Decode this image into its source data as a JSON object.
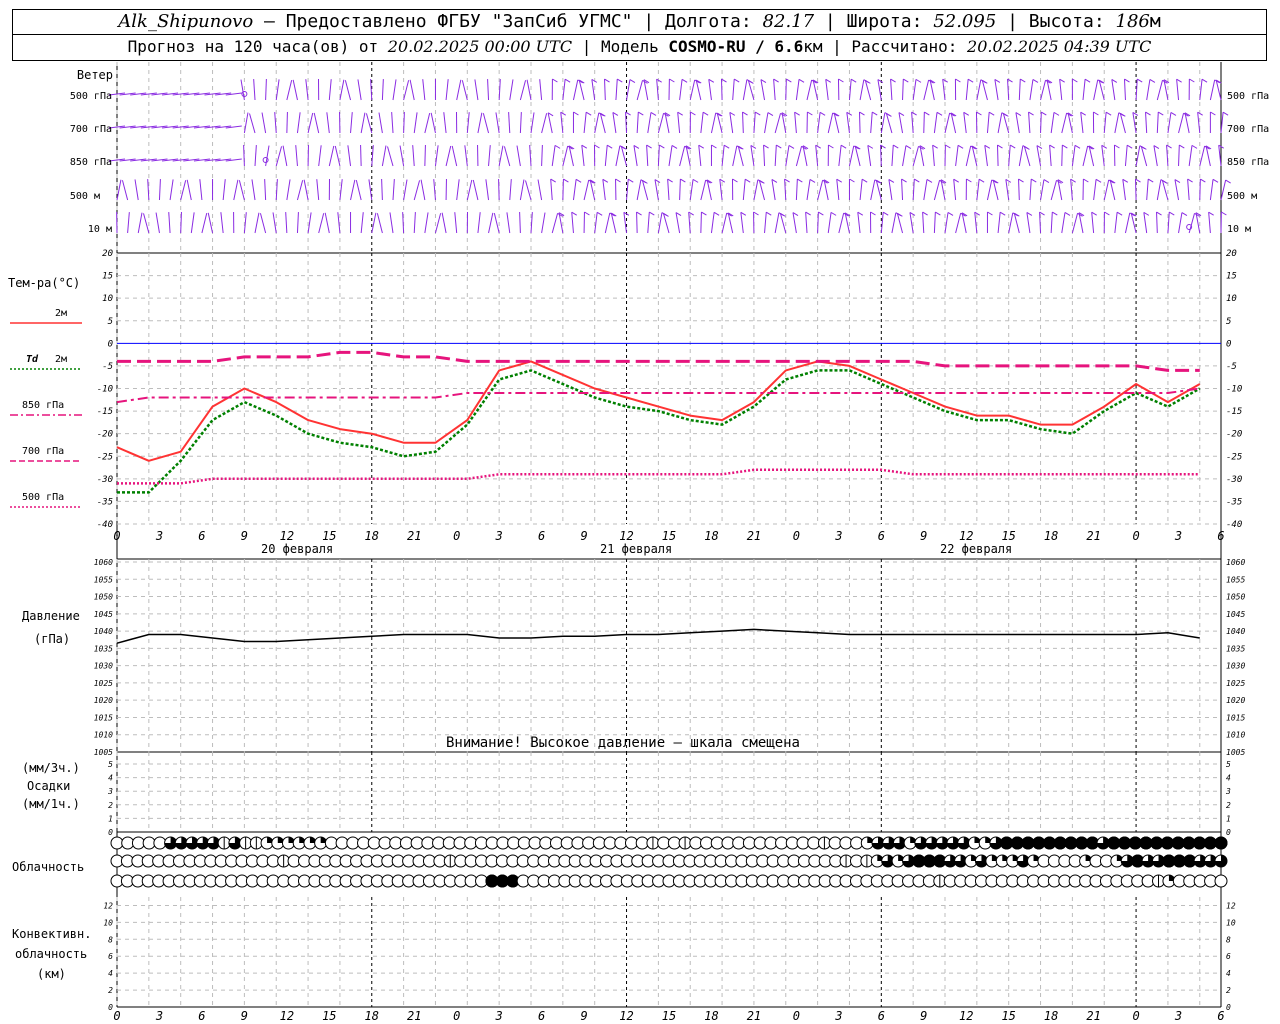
{
  "header": {
    "station": "Alk_Shipunovo",
    "provided_by": " – Предоставлено ФГБУ \"ЗапСиб УГМС\" | Долгота: ",
    "lon": "82.17",
    "lat_label": " | Широта: ",
    "lat": "52.095",
    "alt_label": " | Высота: ",
    "alt": "186",
    "alt_unit": "м",
    "forecast_label": "Прогноз на 120 часа(ов) от ",
    "forecast_from": "20.02.2025 00:00 UTC",
    "model_label": " | Модель ",
    "model": "COSMO-RU / 6.6",
    "model_unit": "км",
    "computed_label": " | Рассчитано: ",
    "computed": "20.02.2025 04:39 UTC"
  },
  "labels": {
    "wind_title": "Ветер",
    "wind_levels": [
      "500 гПа",
      "700 гПа",
      "850 гПа",
      "500 м",
      "10  м"
    ],
    "temp_title": "Тем-ра(°С)",
    "legend_t2m": "2м",
    "legend_td_sym": "Td",
    "legend_td": "2м",
    "legend_850": "850 гПа",
    "legend_700": "700 гПа",
    "legend_500": "500 гПа",
    "pressure_title": "Давление",
    "pressure_unit": "(гПа)",
    "pressure_warning": "Внимание! Высокое давление – шкала смещена",
    "precip_unit3": "(мм/3ч.)",
    "precip_title": "Осадки",
    "precip_unit1": "(мм/1ч.)",
    "cloud_title": "Облачность",
    "conv_title1": "Конвективн.",
    "conv_title2": "облачность",
    "conv_unit": "(км)",
    "days": [
      "20 февраля",
      "21 февраля",
      "22 февраля"
    ]
  },
  "colors": {
    "t2m": "#ff3333",
    "td": "#008000",
    "t850": "#e6147d",
    "t700": "#e6147d",
    "t500": "#e6147d",
    "wind": "#8a2be2",
    "zero_line": "#0000ff",
    "pressure": "#000000"
  },
  "chart_data": [
    {
      "type": "line",
      "panel": "temperature",
      "x_hours": [
        0,
        3,
        6,
        9,
        12,
        15,
        18,
        21,
        24,
        27,
        30,
        33,
        36,
        39,
        42,
        45,
        48,
        51,
        54,
        57,
        60,
        63,
        66,
        69,
        72,
        75,
        78,
        81,
        84,
        87,
        90,
        93,
        96,
        99,
        102
      ],
      "x_ticks": [
        "0",
        "3",
        "6",
        "9",
        "12",
        "15",
        "18",
        "21",
        "0",
        "3",
        "6",
        "9",
        "12",
        "15",
        "18",
        "21",
        "0",
        "3",
        "6",
        "9",
        "12",
        "15",
        "18",
        "21",
        "0",
        "3",
        "6"
      ],
      "ylim": [
        -40,
        20
      ],
      "y_ticks": [
        20,
        15,
        10,
        5,
        0,
        -5,
        -10,
        -15,
        -20,
        -25,
        -30,
        -35,
        -40
      ],
      "series": [
        {
          "name": "2м",
          "values": [
            -23,
            -26,
            -24,
            -14,
            -10,
            -13,
            -17,
            -19,
            -20,
            -22,
            -22,
            -17,
            -6,
            -4,
            -7,
            -10,
            -12,
            -14,
            -16,
            -17,
            -13,
            -6,
            -4,
            -5,
            -8,
            -11,
            -14,
            -16,
            -16,
            -18,
            -18,
            -14,
            -9,
            -13,
            -9
          ]
        },
        {
          "name": "Td 2м",
          "values": [
            -33,
            -33,
            -26,
            -17,
            -13,
            -16,
            -20,
            -22,
            -23,
            -25,
            -24,
            -18,
            -8,
            -6,
            -9,
            -12,
            -14,
            -15,
            -17,
            -18,
            -14,
            -8,
            -6,
            -6,
            -9,
            -12,
            -15,
            -17,
            -17,
            -19,
            -20,
            -15,
            -11,
            -14,
            -10
          ]
        },
        {
          "name": "850 гПа",
          "values": [
            -13,
            -12,
            -12,
            -12,
            -12,
            -12,
            -12,
            -12,
            -12,
            -12,
            -12,
            -11,
            -11,
            -11,
            -11,
            -11,
            -11,
            -11,
            -11,
            -11,
            -11,
            -11,
            -11,
            -11,
            -11,
            -11,
            -11,
            -11,
            -11,
            -11,
            -11,
            -11,
            -11,
            -11,
            -10
          ]
        },
        {
          "name": "700 гПа",
          "values": [
            -4,
            -4,
            -4,
            -4,
            -3,
            -3,
            -3,
            -2,
            -2,
            -3,
            -3,
            -4,
            -4,
            -4,
            -4,
            -4,
            -4,
            -4,
            -4,
            -4,
            -4,
            -4,
            -4,
            -4,
            -4,
            -4,
            -5,
            -5,
            -5,
            -5,
            -5,
            -5,
            -5,
            -6,
            -6
          ]
        },
        {
          "name": "500 гПа",
          "values": [
            -31,
            -31,
            -31,
            -30,
            -30,
            -30,
            -30,
            -30,
            -30,
            -30,
            -30,
            -30,
            -29,
            -29,
            -29,
            -29,
            -29,
            -29,
            -29,
            -29,
            -28,
            -28,
            -28,
            -28,
            -28,
            -29,
            -29,
            -29,
            -29,
            -29,
            -29,
            -29,
            -29,
            -29,
            -29
          ]
        }
      ]
    },
    {
      "type": "line",
      "panel": "pressure",
      "ylim": [
        1005,
        1060
      ],
      "y_ticks": [
        1060,
        1055,
        1050,
        1045,
        1040,
        1035,
        1030,
        1025,
        1020,
        1015,
        1010,
        1005
      ],
      "series": [
        {
          "name": "Давление",
          "values": [
            1036.5,
            1039,
            1039,
            1038,
            1037,
            1037,
            1037.5,
            1038,
            1038.5,
            1039,
            1039,
            1039,
            1038,
            1038,
            1038.5,
            1038.5,
            1039,
            1039,
            1039.5,
            1040,
            1040.5,
            1040,
            1039.5,
            1039,
            1039,
            1039,
            1039,
            1039,
            1039,
            1039,
            1039,
            1039,
            1039,
            1039.5,
            1038
          ]
        }
      ]
    },
    {
      "type": "bar",
      "panel": "precipitation",
      "ylim": [
        0,
        5
      ],
      "y_ticks": [
        5,
        4,
        3,
        2,
        1,
        0
      ],
      "series": [
        {
          "name": "Осадки",
          "values": []
        }
      ]
    },
    {
      "type": "table",
      "panel": "cloudiness",
      "rows": [
        {
          "level": "upper",
          "values": [
            0,
            0,
            0,
            0,
            0,
            3,
            3,
            3,
            3,
            3,
            1,
            3,
            1,
            1,
            2,
            2,
            2,
            2,
            2,
            2,
            0,
            0,
            0,
            0,
            0,
            0,
            0,
            0,
            0,
            0,
            0,
            0,
            0,
            0,
            0,
            0,
            0,
            0,
            0,
            0,
            0,
            0,
            0,
            0,
            0,
            0,
            0,
            0,
            0,
            0,
            1,
            0,
            0,
            1,
            0,
            0,
            0,
            0,
            0,
            0,
            0,
            0,
            0,
            0,
            0,
            0,
            1,
            0,
            0,
            0,
            2,
            3,
            3,
            3,
            2,
            3,
            3,
            3,
            3,
            3,
            2,
            2,
            3,
            4,
            4,
            4,
            4,
            4,
            4,
            4,
            4,
            4,
            3,
            4,
            4,
            4,
            4,
            4,
            4,
            4,
            4,
            4,
            4,
            4
          ]
        },
        {
          "level": "middle",
          "values": [
            0,
            0,
            0,
            0,
            0,
            0,
            0,
            0,
            0,
            0,
            0,
            0,
            0,
            0,
            0,
            0,
            1,
            0,
            0,
            0,
            0,
            0,
            0,
            0,
            0,
            0,
            0,
            0,
            0,
            0,
            0,
            0,
            1,
            0,
            0,
            0,
            0,
            0,
            0,
            0,
            0,
            0,
            0,
            0,
            0,
            0,
            0,
            0,
            0,
            0,
            0,
            0,
            0,
            0,
            0,
            0,
            0,
            0,
            0,
            0,
            0,
            0,
            0,
            0,
            0,
            0,
            0,
            0,
            0,
            0,
            1,
            0,
            1,
            2,
            3,
            2,
            3,
            4,
            4,
            4,
            3,
            3,
            2,
            3,
            2,
            2,
            2,
            3,
            2,
            0,
            0,
            0,
            0,
            2,
            0,
            0,
            2,
            3,
            4,
            3,
            3,
            4,
            4,
            4,
            3,
            3,
            3
          ]
        },
        {
          "level": "lower",
          "values": [
            0,
            0,
            0,
            0,
            0,
            0,
            0,
            0,
            0,
            0,
            0,
            0,
            0,
            0,
            0,
            0,
            0,
            0,
            0,
            0,
            0,
            0,
            0,
            0,
            0,
            0,
            0,
            0,
            0,
            0,
            0,
            0,
            0,
            0,
            0,
            0,
            4,
            4,
            4,
            0,
            0,
            0,
            0,
            0,
            0,
            0,
            0,
            0,
            0,
            0,
            0,
            0,
            0,
            0,
            0,
            0,
            0,
            0,
            0,
            0,
            0,
            0,
            0,
            0,
            0,
            0,
            0,
            0,
            0,
            0,
            0,
            0,
            0,
            0,
            0,
            0,
            0,
            0,
            0,
            1,
            0,
            0,
            0,
            0,
            0,
            0,
            0,
            0,
            0,
            0,
            0,
            0,
            0,
            0,
            0,
            0,
            0,
            0,
            0,
            0,
            1,
            2,
            0,
            0,
            0,
            0,
            0
          ]
        }
      ]
    },
    {
      "type": "bar",
      "panel": "convective_cloud",
      "ylim": [
        0,
        13
      ],
      "y_ticks": [
        12,
        10,
        8,
        6,
        4,
        2,
        0
      ],
      "series": [
        {
          "name": "Конвективн. облачность",
          "values": []
        }
      ]
    }
  ]
}
